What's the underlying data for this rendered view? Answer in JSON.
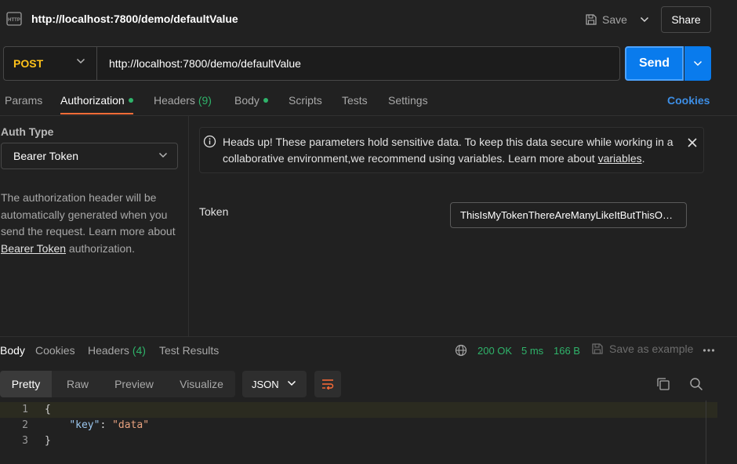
{
  "request": {
    "title": "http://localhost:7800/demo/defaultValue",
    "save_label": "Save",
    "share_label": "Share",
    "method": "POST",
    "url": "http://localhost:7800/demo/defaultValue",
    "send_label": "Send",
    "method_color": "#ffc21a"
  },
  "tabs": {
    "params": "Params",
    "authorization": "Authorization",
    "headers": "Headers",
    "headers_count": "(9)",
    "body": "Body",
    "scripts": "Scripts",
    "tests": "Tests",
    "settings": "Settings",
    "cookies": "Cookies",
    "active": "Authorization"
  },
  "auth": {
    "type_label": "Auth Type",
    "type_value": "Bearer Token",
    "desc_1": "The authorization header will be automatically generated when you send the request. Learn more about ",
    "desc_link": "Bearer Token",
    "desc_2": " authorization.",
    "alert_text_1": "Heads up! These parameters hold sensitive data. To keep this data secure while working in a collaborative environment,we recommend using variables. Learn more about ",
    "alert_link": "variables",
    "alert_text_2": ".",
    "token_label": "Token",
    "token_value": "ThisIsMyTokenThereAreManyLikeItButThisOneIsMine"
  },
  "response": {
    "tabs": {
      "body": "Body",
      "cookies": "Cookies",
      "headers": "Headers",
      "headers_count": "(4)",
      "test_results": "Test Results"
    },
    "status": "200 OK",
    "time": "5 ms",
    "size": "166 B",
    "save_example": "Save as example",
    "views": {
      "pretty": "Pretty",
      "raw": "Raw",
      "preview": "Preview",
      "visualize": "Visualize"
    },
    "format": "JSON",
    "lines": [
      {
        "num": "1",
        "open": "{"
      },
      {
        "num": "2",
        "key": "\"key\"",
        "sep": ": ",
        "value": "\"data\""
      },
      {
        "num": "3",
        "close": "}"
      }
    ],
    "status_color": "#2fb36a"
  },
  "icons": {
    "request": "http-request-icon",
    "save": "floppy-disk-icon",
    "info": "info-icon",
    "close": "close-icon",
    "globe": "globe-icon",
    "more": "more-horizontal-icon",
    "wrap": "wrap-lines-icon",
    "copy": "copy-icon",
    "search": "search-icon"
  }
}
